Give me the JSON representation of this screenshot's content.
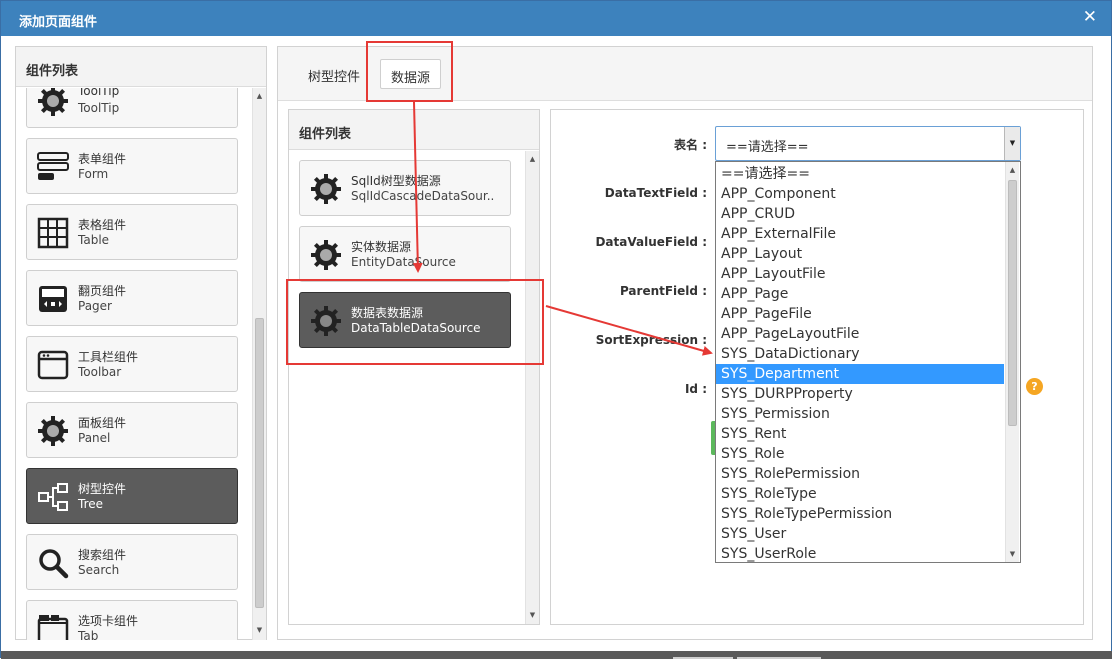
{
  "dialog": {
    "title": "添加页面组件",
    "close_glyph": "✕"
  },
  "left_panel": {
    "header": "组件列表",
    "items": [
      {
        "cn": "ToolTip",
        "en": "ToolTip",
        "icon": "gear-icon"
      },
      {
        "cn": "表单组件",
        "en": "Form",
        "icon": "form-icon"
      },
      {
        "cn": "表格组件",
        "en": "Table",
        "icon": "table-icon"
      },
      {
        "cn": "翻页组件",
        "en": "Pager",
        "icon": "pager-icon"
      },
      {
        "cn": "工具栏组件",
        "en": "Toolbar",
        "icon": "toolbar-icon"
      },
      {
        "cn": "面板组件",
        "en": "Panel",
        "icon": "gear-icon"
      },
      {
        "cn": "树型控件",
        "en": "Tree",
        "icon": "tree-icon",
        "active": true
      },
      {
        "cn": "搜索组件",
        "en": "Search",
        "icon": "search-icon"
      },
      {
        "cn": "选项卡组件",
        "en": "Tab",
        "icon": "tab-icon"
      }
    ]
  },
  "tabs": [
    {
      "label": "树型控件",
      "selected": false
    },
    {
      "label": "数据源",
      "selected": true
    }
  ],
  "mid_panel": {
    "header": "组件列表",
    "items": [
      {
        "cn": "SqlId树型数据源",
        "en": "SqlIdCascadeDataSour..",
        "icon": "gear-icon"
      },
      {
        "cn": "实体数据源",
        "en": "EntityDataSource",
        "icon": "gear-icon"
      },
      {
        "cn": "数据表数据源",
        "en": "DataTableDataSource",
        "icon": "gear-icon",
        "active": true
      }
    ]
  },
  "form": {
    "labels": {
      "table_name": "表名 :",
      "data_text_field": "DataTextField :",
      "data_value_field": "DataValueField :",
      "parent_field": "ParentField :",
      "sort_expression": "SortExpression :",
      "id": "Id :"
    },
    "select_value": "==请选择==",
    "options": [
      "==请选择==",
      "APP_Component",
      "APP_CRUD",
      "APP_ExternalFile",
      "APP_Layout",
      "APP_LayoutFile",
      "APP_Page",
      "APP_PageFile",
      "APP_PageLayoutFile",
      "SYS_DataDictionary",
      "SYS_Department",
      "SYS_DURPProperty",
      "SYS_Permission",
      "SYS_Rent",
      "SYS_Role",
      "SYS_RolePermission",
      "SYS_RoleType",
      "SYS_RoleTypePermission",
      "SYS_User",
      "SYS_UserRole"
    ],
    "highlighted_index": 10,
    "help_glyph": "?"
  },
  "colors": {
    "titlebar": "#3d82bd",
    "highlight": "#3399ff",
    "annotation": "#e53935",
    "active_item": "#5c5c5c"
  }
}
